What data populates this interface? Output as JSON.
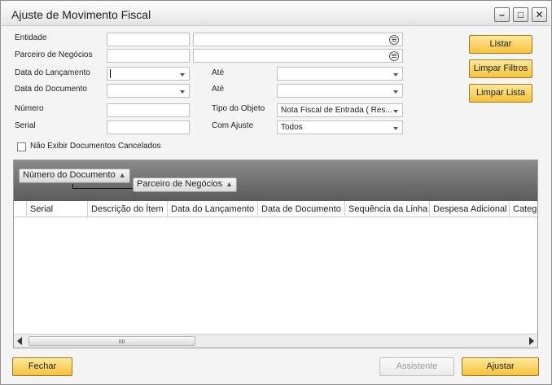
{
  "window": {
    "title": "Ajuste de Movimento Fiscal"
  },
  "form": {
    "entidade_label": "Entidade",
    "parceiro_label": "Parceiro de Negócios",
    "data_lancamento_label": "Data do Lançamento",
    "data_documento_label": "Data do Documento",
    "ate1_label": "Até",
    "ate2_label": "Até",
    "numero_label": "Número",
    "serial_label": "Serial",
    "tipo_objeto_label": "Tipo do Objeto",
    "tipo_objeto_value": "Nota Fiscal de Entrada ( Res...",
    "com_ajuste_label": "Com Ajuste",
    "com_ajuste_value": "Todos",
    "nao_exibir_label": "Não Exibir Documentos Cancelados"
  },
  "buttons": {
    "listar": "Listar",
    "limpar_filtros": "Limpar Filtros",
    "limpar_lista": "Limpar Lista",
    "fechar": "Fechar",
    "assistente": "Assistente",
    "ajustar": "Ajustar"
  },
  "grid": {
    "group_by": [
      "Número do Documento",
      "Parceiro de Negócios"
    ],
    "columns": [
      "Serial",
      "Descrição do Ítem",
      "Data do Lançamento",
      "Data de Documento",
      "Sequência da Linha",
      "Despesa Adicional",
      "Categ"
    ]
  },
  "colors": {
    "accent_button": "#f6c23c",
    "group_bar": "#6e6e6e"
  }
}
